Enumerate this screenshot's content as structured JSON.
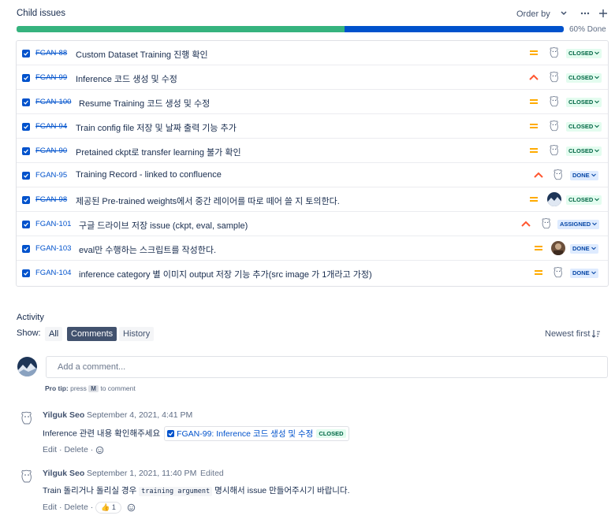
{
  "child_issues": {
    "title": "Child issues",
    "order_by_label": "Order by",
    "progress_label": "60% Done",
    "progress": {
      "done_fraction": 0.6,
      "done_color": "#36b37e",
      "in_progress_fraction": 0.4,
      "in_progress_color": "#0052cc"
    },
    "issues": [
      {
        "key": "FGAN-88",
        "summary": "Custom Dataset Training 진행 확인",
        "done": true,
        "priority": "medium",
        "assignee": "bear-avatar",
        "status": "CLOSED"
      },
      {
        "key": "FGAN-99",
        "summary": "Inference 코드 생성 및 수정",
        "done": true,
        "priority": "high",
        "assignee": "bear-avatar",
        "status": "CLOSED"
      },
      {
        "key": "FGAN-100",
        "summary": "Resume Training 코드 생성 및 수정",
        "done": true,
        "priority": "medium",
        "assignee": "bear-avatar",
        "status": "CLOSED"
      },
      {
        "key": "FGAN-94",
        "summary": "Train config file 저장 및 날짜 출력 기능 추가",
        "done": true,
        "priority": "medium",
        "assignee": "bear-avatar",
        "status": "CLOSED"
      },
      {
        "key": "FGAN-90",
        "summary": "Pretained ckpt로 transfer learning 불가 확인",
        "done": true,
        "priority": "medium",
        "assignee": "bear-avatar",
        "status": "CLOSED"
      },
      {
        "key": "FGAN-95",
        "summary": "Training Record - linked to confluence",
        "done": false,
        "priority": "high",
        "assignee": "bear-avatar",
        "status": "DONE"
      },
      {
        "key": "FGAN-98",
        "summary": "제공된 Pre-trained weights에서 중간 레이어를 따로 떼어 쓸 지 토의한다.",
        "done": true,
        "priority": "medium",
        "assignee": "mountain-avatar",
        "status": "CLOSED"
      },
      {
        "key": "FGAN-101",
        "summary": "구글 드라이브 저장 issue (ckpt, eval, sample)",
        "done": false,
        "priority": "high",
        "assignee": "bear-avatar",
        "status": "ASSIGNED"
      },
      {
        "key": "FGAN-103",
        "summary": "eval만 수행하는 스크립트를 작성한다.",
        "done": false,
        "priority": "medium",
        "assignee": "photo-avatar",
        "status": "DONE"
      },
      {
        "key": "FGAN-104",
        "summary": "inference category 별 이미지 output 저장 기능 추가(src image 가 1개라고 가정)",
        "done": false,
        "priority": "medium",
        "assignee": "bear-avatar",
        "status": "DONE"
      }
    ]
  },
  "activity": {
    "title": "Activity",
    "show_label": "Show:",
    "filters": {
      "all": "All",
      "comments": "Comments",
      "history": "History"
    },
    "sort_label": "Newest first",
    "comment_placeholder": "Add a comment...",
    "pro_tip": {
      "label": "Pro tip:",
      "pre": "press",
      "key": "M",
      "post": "to comment"
    },
    "comments": [
      {
        "author": "Yilguk Seo",
        "date": "September 4, 2021, 4:41 PM",
        "text": "Inference 관련 내용 확인해주세요",
        "linked_issue": {
          "key": "FGAN-99",
          "summary": "Inference 코드 생성 및 수정",
          "label": "FGAN-99: Inference 코드 생성 및 수정",
          "status": "CLOSED"
        },
        "edit": "Edit",
        "delete": "Delete"
      },
      {
        "author": "Yilguk Seo",
        "date": "September 1, 2021, 11:40 PM",
        "edited": "Edited",
        "text_before": "Train 돌리거나 돌리실 경우",
        "code": "training argument",
        "text_after": "명시해서 issue 만들어주시기 바랍니다.",
        "reaction": {
          "emoji": "👍",
          "count": "1"
        },
        "edit": "Edit",
        "delete": "Delete"
      }
    ]
  }
}
